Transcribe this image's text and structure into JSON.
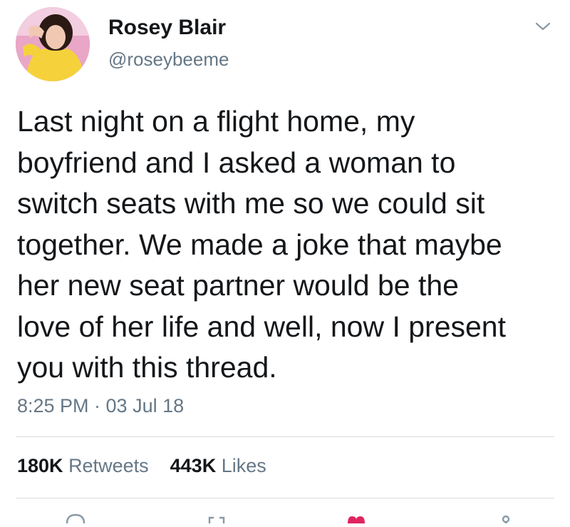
{
  "author": {
    "display_name": "Rosey Blair",
    "handle": "@roseybeeme"
  },
  "tweet": {
    "lines": [
      "Last night on a flight home, my",
      "boyfriend and I asked a woman to",
      "switch seats with me so we could sit",
      "together. We made a joke that maybe",
      "her new seat partner would be the",
      "love of her life and well, now I present",
      "you with this thread."
    ],
    "timestamp": "8:25 PM · 03 Jul 18"
  },
  "stats": {
    "retweets_count": "180K",
    "retweets_label": "Retweets",
    "likes_count": "443K",
    "likes_label": "Likes"
  },
  "icons": {
    "menu": "chevron-down-icon",
    "reply": "reply-icon",
    "retweet": "retweet-icon",
    "like": "heart-icon",
    "share": "share-icon"
  },
  "colors": {
    "text": "#14171a",
    "secondary": "#657786",
    "divider": "#d7dde2",
    "like": "#e0245e"
  }
}
